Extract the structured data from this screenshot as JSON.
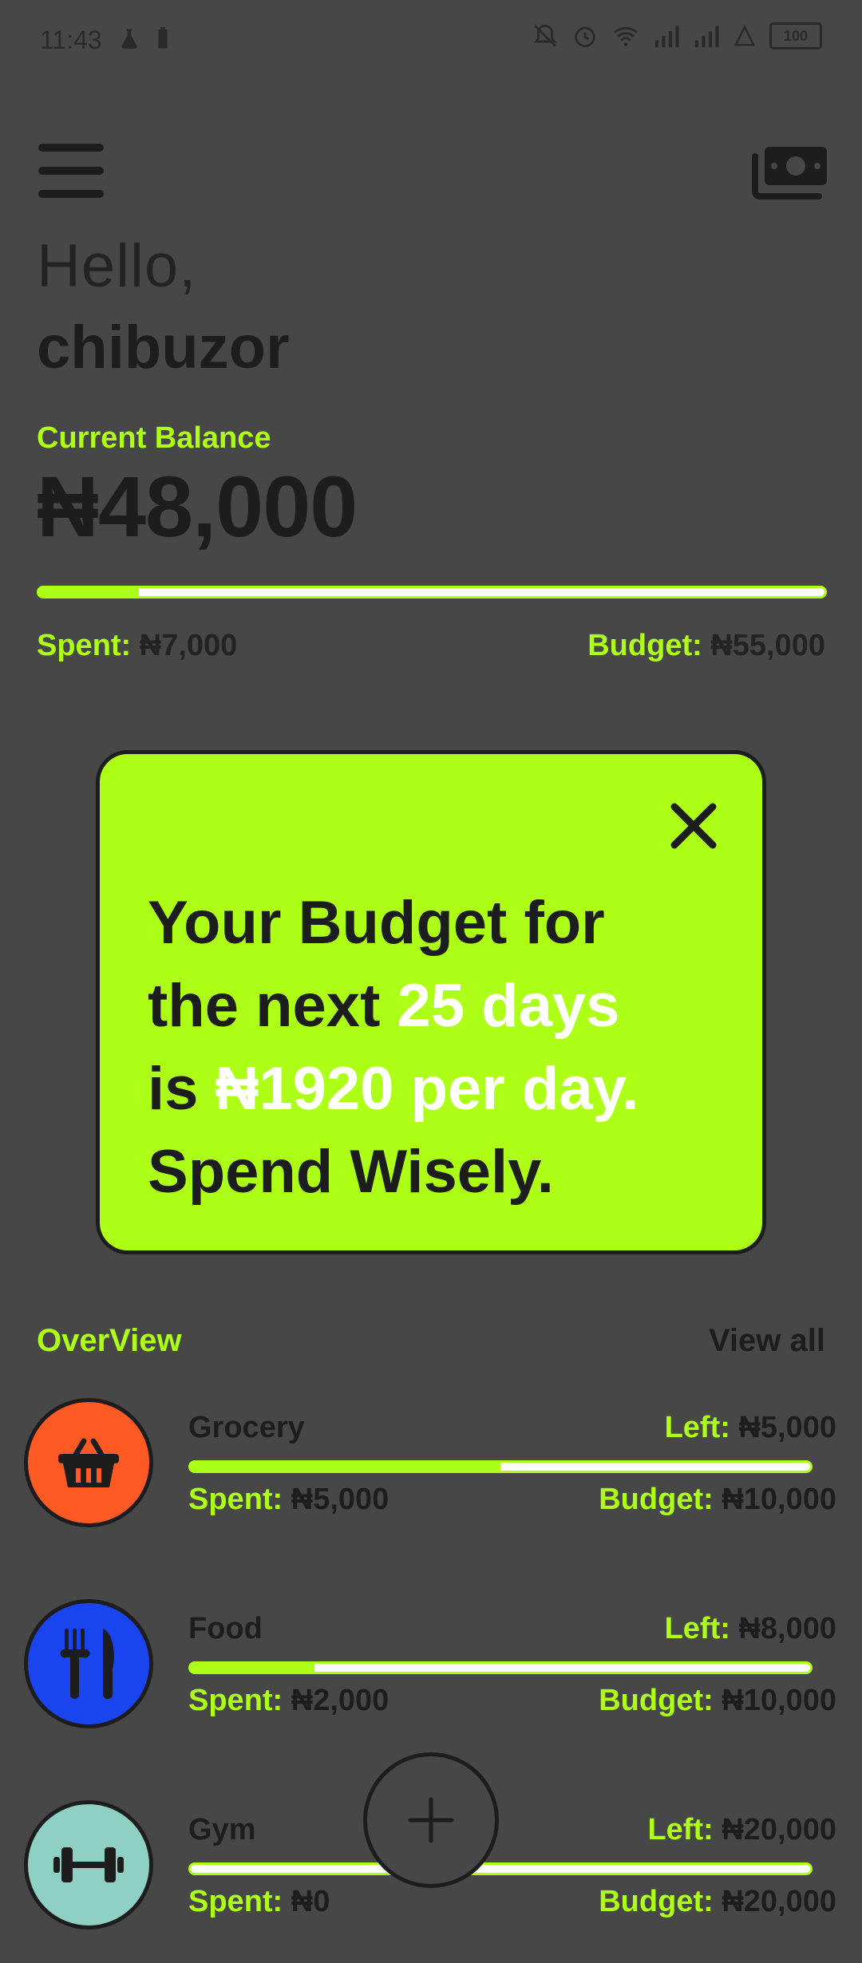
{
  "status": {
    "time": "11:43",
    "battery": "100"
  },
  "header": {
    "greeting": "Hello,",
    "username": "chibuzor"
  },
  "balance": {
    "label": "Current Balance",
    "amount": "₦48,000",
    "spent_label": "Spent:",
    "spent_value": "₦7,000",
    "budget_label": "Budget:",
    "budget_value": "₦55,000",
    "progress_fraction": 0.127
  },
  "popup": {
    "line1": "Your Budget for",
    "line2_a": "the next ",
    "line2_b": "25 days",
    "line3_a": "is ",
    "line3_b": "₦1920 per day.",
    "line4": "Spend Wisely."
  },
  "overview": {
    "title": "OverView",
    "view_all": "View all",
    "categories": [
      {
        "name": "Grocery",
        "left_label": "Left:",
        "left_value": "₦5,000",
        "spent_label": "Spent:",
        "spent_value": "₦5,000",
        "budget_label": "Budget:",
        "budget_value": "₦10,000",
        "progress_fraction": 0.5,
        "icon": "basket-icon",
        "color": "#ff5a23"
      },
      {
        "name": "Food",
        "left_label": "Left:",
        "left_value": "₦8,000",
        "spent_label": "Spent:",
        "spent_value": "₦2,000",
        "budget_label": "Budget:",
        "budget_value": "₦10,000",
        "progress_fraction": 0.2,
        "icon": "fork-knife-icon",
        "color": "#1a44ee"
      },
      {
        "name": "Gym",
        "left_label": "Left:",
        "left_value": "₦20,000",
        "spent_label": "Spent:",
        "spent_value": "₦0",
        "budget_label": "Budget:",
        "budget_value": "₦20,000",
        "progress_fraction": 0.0,
        "icon": "dumbbell-icon",
        "color": "#8fd0c4"
      }
    ]
  },
  "colors": {
    "accent": "#aeff18",
    "background": "#474747",
    "dark": "#1d1d1d"
  }
}
